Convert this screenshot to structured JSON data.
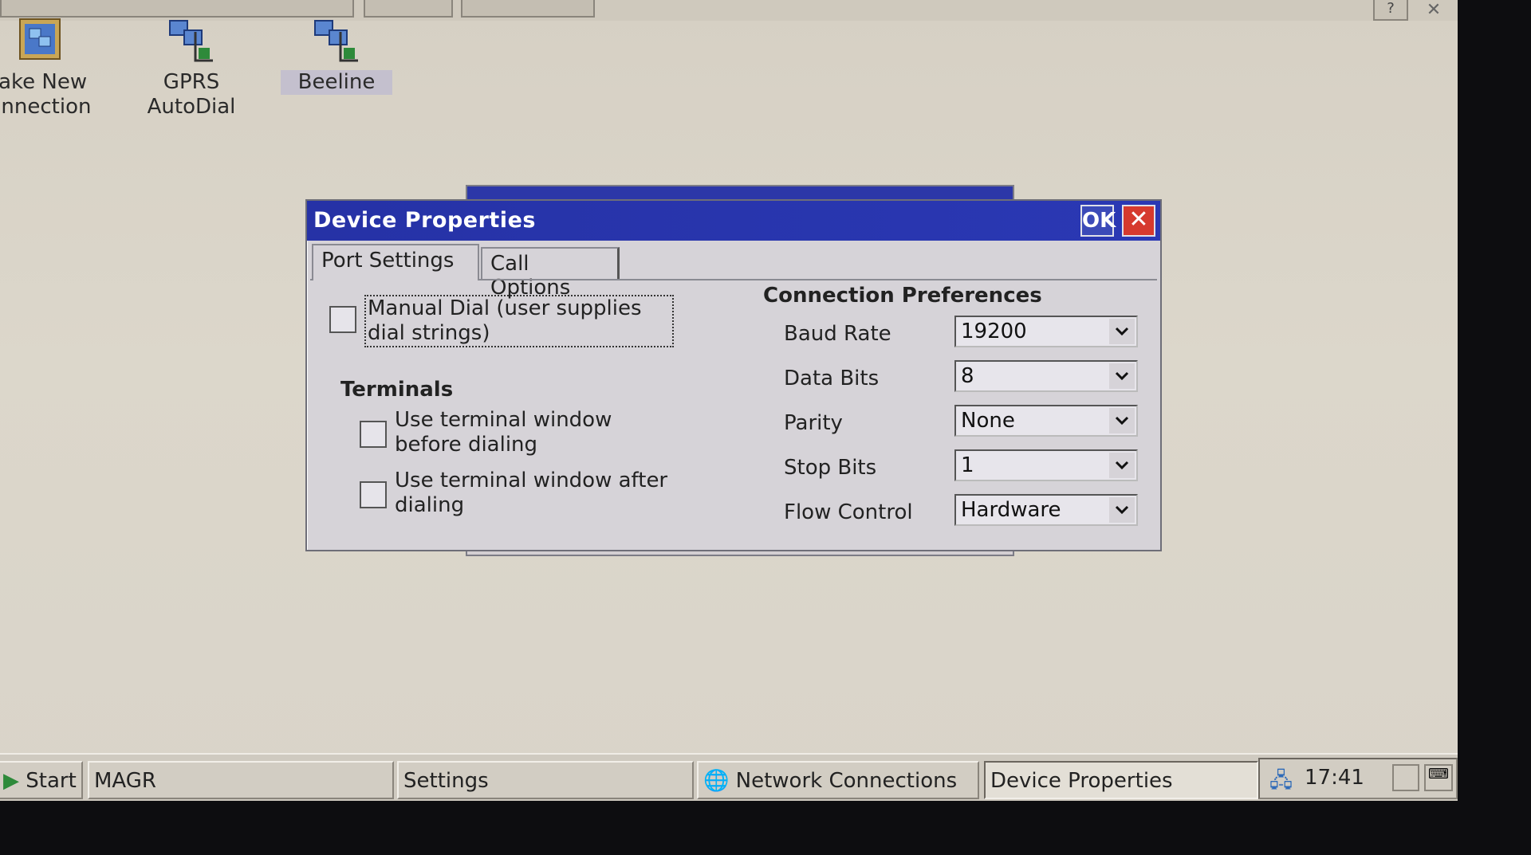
{
  "desktop": {
    "icons": [
      {
        "label_line1": "lake New",
        "label_line2": "onnection"
      },
      {
        "label_line1": "GPRS",
        "label_line2": "AutoDial"
      },
      {
        "label_line1": "Beeline"
      }
    ]
  },
  "dialog": {
    "title": "Device Properties",
    "ok_label": "OK",
    "close_label": "✕",
    "tabs": [
      {
        "label": "Port Settings",
        "active": true
      },
      {
        "label": "Call Options",
        "active": false
      }
    ],
    "manual_dial": {
      "label": "Manual Dial (user supplies dial strings)",
      "checked": false
    },
    "terminals": {
      "heading": "Terminals",
      "before": {
        "label": "Use terminal window before dialing",
        "checked": false
      },
      "after": {
        "label": "Use terminal window after dialing",
        "checked": false
      }
    },
    "connection_preferences": {
      "heading": "Connection Preferences",
      "fields": [
        {
          "label": "Baud Rate",
          "value": "19200"
        },
        {
          "label": "Data Bits",
          "value": "8"
        },
        {
          "label": "Parity",
          "value": "None"
        },
        {
          "label": "Stop Bits",
          "value": "1"
        },
        {
          "label": "Flow Control",
          "value": "Hardware"
        }
      ]
    }
  },
  "taskbar": {
    "start_label": "Start",
    "items": [
      {
        "label": "MAGR"
      },
      {
        "label": "Settings"
      },
      {
        "label": "Network Connections"
      },
      {
        "label": "Device Properties"
      }
    ],
    "clock": "17:41"
  },
  "colors": {
    "titlebar": "#2632a6",
    "close_button": "#d63a2e",
    "desktop": "#d9d4c9"
  }
}
